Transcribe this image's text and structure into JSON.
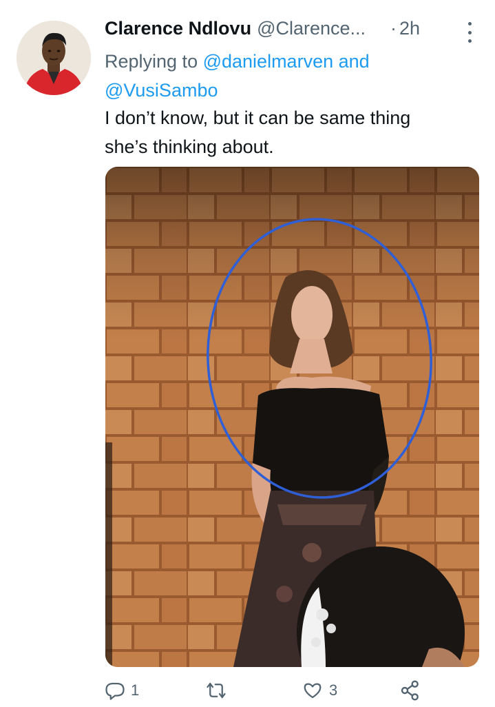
{
  "tweet": {
    "display_name": "Clarence Ndlovu",
    "handle": "@Clarence...",
    "separator": "·",
    "time": "2h",
    "replying_prefix": "Replying to ",
    "mention_1": "@danielmarven",
    "mention_joiner": " and",
    "mention_2": "@VusiSambo",
    "text_line_1": "I don’t know, but it can be same thing",
    "text_line_2": "she’s thinking about.",
    "media_description": "photo",
    "actions": {
      "reply_count": "1",
      "retweet_count": "",
      "like_count": "3"
    }
  },
  "icons": {
    "reply": "reply-icon",
    "retweet": "retweet-icon",
    "like": "heart-icon",
    "share": "share-icon",
    "more": "more-options-icon"
  },
  "colors": {
    "link": "#1d9bf0",
    "secondary_text": "#536471",
    "primary_text": "#0f1419",
    "annotation_circle": "#2e5fd6"
  }
}
